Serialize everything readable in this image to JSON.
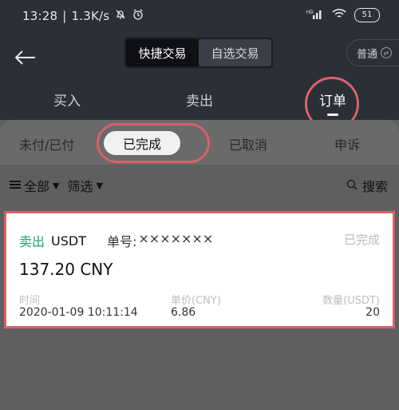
{
  "status_bar": {
    "time": "13:28",
    "net_speed": "1.3K/s",
    "mute_icon": "bell-off-icon",
    "alarm_icon": "alarm-icon",
    "signal_label": "HD",
    "battery": "51"
  },
  "header": {
    "back_icon": "back-arrow-icon",
    "segments": [
      "快捷交易",
      "自选交易"
    ],
    "mode_label": "普通"
  },
  "tabs": [
    "买入",
    "卖出",
    "订单"
  ],
  "subtabs": [
    "未付/已付",
    "已完成",
    "已取消",
    "申诉"
  ],
  "filters": {
    "all_label": "全部",
    "filter_label": "筛选",
    "search_label": "搜索"
  },
  "order": {
    "side": "卖出",
    "asset": "USDT",
    "order_no_label": "单号:",
    "order_no_value": "×××××××",
    "status": "已完成",
    "amount": "137.20 CNY",
    "time_label": "时间",
    "time_value": "2020-01-09 10:11:14",
    "price_label": "单价(CNY)",
    "price_value": "6.86",
    "qty_label": "数量(USDT)",
    "qty_value": "20"
  },
  "colors": {
    "dark_bg": "#2b2f36",
    "overlay_bg": "#5f5f5f",
    "accent_green": "#1aa56b",
    "highlight_red": "#d9606a"
  }
}
